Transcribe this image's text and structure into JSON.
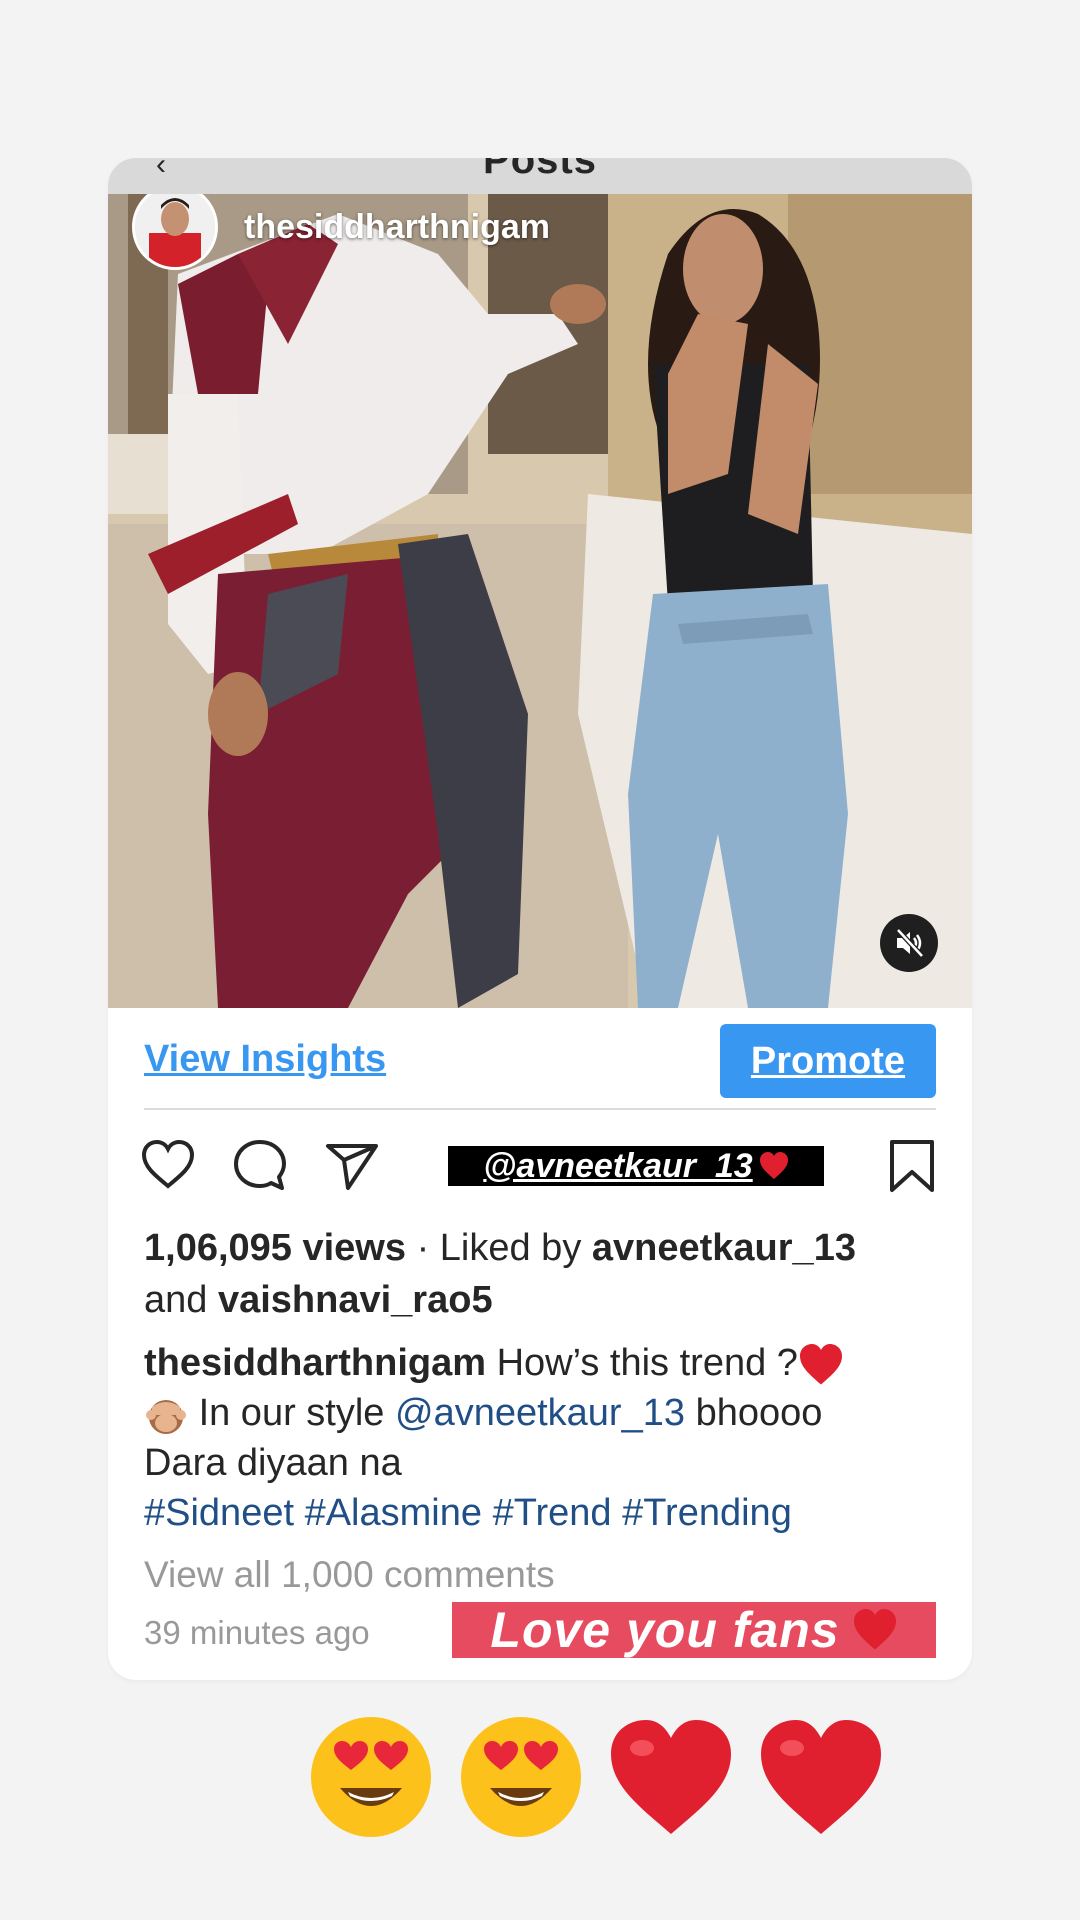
{
  "screen": {
    "title": "Posts"
  },
  "post": {
    "username": "thesiddharthnigam",
    "mute_icon": "volume-mute-icon"
  },
  "insights": {
    "view_insights": "View Insights",
    "promote": "Promote"
  },
  "actions": {
    "like_icon": "heart-outline-icon",
    "comment_icon": "comment-icon",
    "share_icon": "paper-plane-icon",
    "save_icon": "bookmark-icon"
  },
  "stickers": {
    "mention": "@avneetkaur_13",
    "love": "Love you fans"
  },
  "stats": {
    "views": "1,06,095 views",
    "separator": "·",
    "liked_by_prefix": "Liked by",
    "liker1": "avneetkaur_13",
    "and": "and",
    "liker2": "vaishnavi_rao5"
  },
  "caption": {
    "username": "thesiddharthnigam",
    "text1": "How’s this trend ?",
    "text2": "In our style",
    "mention": "@avneetkaur_13",
    "text3": "bhoooo",
    "text4": "Dara diyaan na",
    "hashtags": [
      "#Sidneet",
      "#Alasmine",
      "#Trend",
      "#Trending"
    ]
  },
  "footer": {
    "comments": "View all 1,000 comments",
    "time": "39 minutes ago"
  },
  "emojis": [
    "heart-eyes-emoji",
    "heart-eyes-emoji",
    "red-heart-emoji",
    "red-heart-emoji"
  ],
  "colors": {
    "accent": "#3897f0",
    "sticker_red": "#e64b5f",
    "link": "#1f4f86",
    "muted": "#999999",
    "text": "#262626"
  }
}
